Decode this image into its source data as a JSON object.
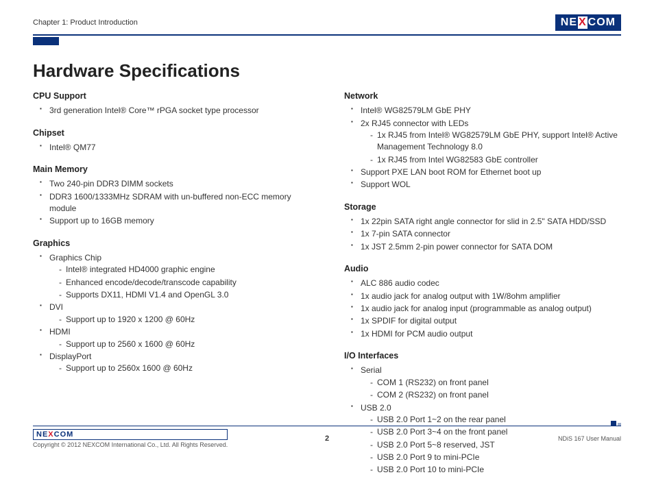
{
  "header": {
    "chapter": "Chapter 1: Product Introduction",
    "logo_pre": "NE",
    "logo_x": "X",
    "logo_post": "COM"
  },
  "title": "Hardware Specifications",
  "left": {
    "s1_title": "CPU Support",
    "s1_i0": "3rd generation Intel® Core™ rPGA socket type processor",
    "s2_title": "Chipset",
    "s2_i0": "Intel® QM77",
    "s3_title": "Main Memory",
    "s3_i0": "Two 240-pin DDR3 DIMM sockets",
    "s3_i1": "DDR3 1600/1333MHz SDRAM with un-buffered non-ECC memory module",
    "s3_i2": "Support up to 16GB memory",
    "s4_title": "Graphics",
    "s4_i0": "Graphics Chip",
    "s4_i0_d0": "Intel® integrated HD4000 graphic engine",
    "s4_i0_d1": "Enhanced encode/decode/transcode capability",
    "s4_i0_d2": "Supports DX11, HDMI V1.4 and OpenGL 3.0",
    "s4_i1": "DVI",
    "s4_i1_d0": "Support up to 1920 x 1200 @ 60Hz",
    "s4_i2": "HDMI",
    "s4_i2_d0": "Support up to 2560 x 1600 @ 60Hz",
    "s4_i3": "DisplayPort",
    "s4_i3_d0": "Support up to 2560x 1600 @ 60Hz"
  },
  "right": {
    "s1_title": "Network",
    "s1_i0": "Intel® WG82579LM GbE PHY",
    "s1_i1": "2x RJ45 connector with LEDs",
    "s1_i1_d0": "1x RJ45 from Intel® WG82579LM GbE PHY, support Intel® Active Management Technology 8.0",
    "s1_i1_d1": "1x RJ45 from Intel WG82583 GbE controller",
    "s1_i2": "Support PXE LAN boot ROM for Ethernet boot up",
    "s1_i3": "Support WOL",
    "s2_title": "Storage",
    "s2_i0": "1x 22pin SATA right angle connector for slid in 2.5\" SATA HDD/SSD",
    "s2_i1": "1x 7-pin SATA connector",
    "s2_i2": "1x JST 2.5mm 2-pin power connector for SATA DOM",
    "s3_title": "Audio",
    "s3_i0": "ALC 886 audio codec",
    "s3_i1": "1x audio jack for analog output with 1W/8ohm amplifier",
    "s3_i2": "1x audio jack for analog input (programmable as analog output)",
    "s3_i3": "1x SPDIF for digital output",
    "s3_i4": "1x HDMI for PCM audio output",
    "s4_title": "I/O Interfaces",
    "s4_i0": "Serial",
    "s4_i0_d0": "COM 1 (RS232) on front panel",
    "s4_i0_d1": "COM 2 (RS232) on front panel",
    "s4_i1": "USB 2.0",
    "s4_i1_d0": "USB 2.0 Port 1~2 on the rear panel",
    "s4_i1_d1": "USB 2.0 Port 3~4 on the front panel",
    "s4_i1_d2": "USB 2.0 Port 5~8 reserved, JST",
    "s4_i1_d3": "USB 2.0 Port 9 to mini-PCIe",
    "s4_i1_d4": "USB 2.0 Port 10 to mini-PCIe"
  },
  "footer": {
    "copyright": "Copyright © 2012 NEXCOM International Co., Ltd. All Rights Reserved.",
    "page": "2",
    "manual": "NDiS 167 User Manual"
  }
}
